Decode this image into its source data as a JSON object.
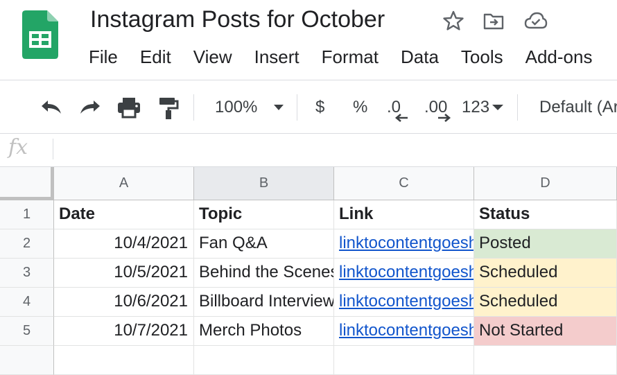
{
  "document": {
    "title": "Instagram Posts for October"
  },
  "header_icons": [
    "star-icon",
    "move-to-folder-icon",
    "cloud-saved-icon"
  ],
  "menu": [
    "File",
    "Edit",
    "View",
    "Insert",
    "Format",
    "Data",
    "Tools",
    "Add-ons"
  ],
  "toolbar": {
    "zoom": "100%",
    "currency": "$",
    "percent": "%",
    "decrease_decimal": ".0",
    "increase_decimal": ".00",
    "more_formats": "123",
    "font": "Default (Ar"
  },
  "formula_bar": {
    "fx_label": "fx",
    "value": ""
  },
  "columns": [
    "A",
    "B",
    "C",
    "D"
  ],
  "rows": [
    {
      "num": "1",
      "date": "Date",
      "topic": "Topic",
      "link": "Link",
      "status": "Status"
    },
    {
      "num": "2",
      "date": "10/4/2021",
      "topic": "Fan Q&A",
      "link": "linktocontentgoeshere",
      "status": "Posted"
    },
    {
      "num": "3",
      "date": "10/5/2021",
      "topic": "Behind the Scenes",
      "link": "linktocontentgoeshere",
      "status": "Scheduled"
    },
    {
      "num": "4",
      "date": "10/6/2021",
      "topic": "Billboard Interview",
      "link": "linktocontentgoeshere",
      "status": "Scheduled"
    },
    {
      "num": "5",
      "date": "10/7/2021",
      "topic": "Merch Photos",
      "link": "linktocontentgoeshere",
      "status": "Not Started"
    }
  ],
  "status_colors": {
    "Posted": "#d9ead3",
    "Scheduled": "#fff2cc",
    "Not Started": "#f4cccc"
  },
  "brand_colors": {
    "sheets_green": "#23a566",
    "link_blue": "#1155cc"
  }
}
